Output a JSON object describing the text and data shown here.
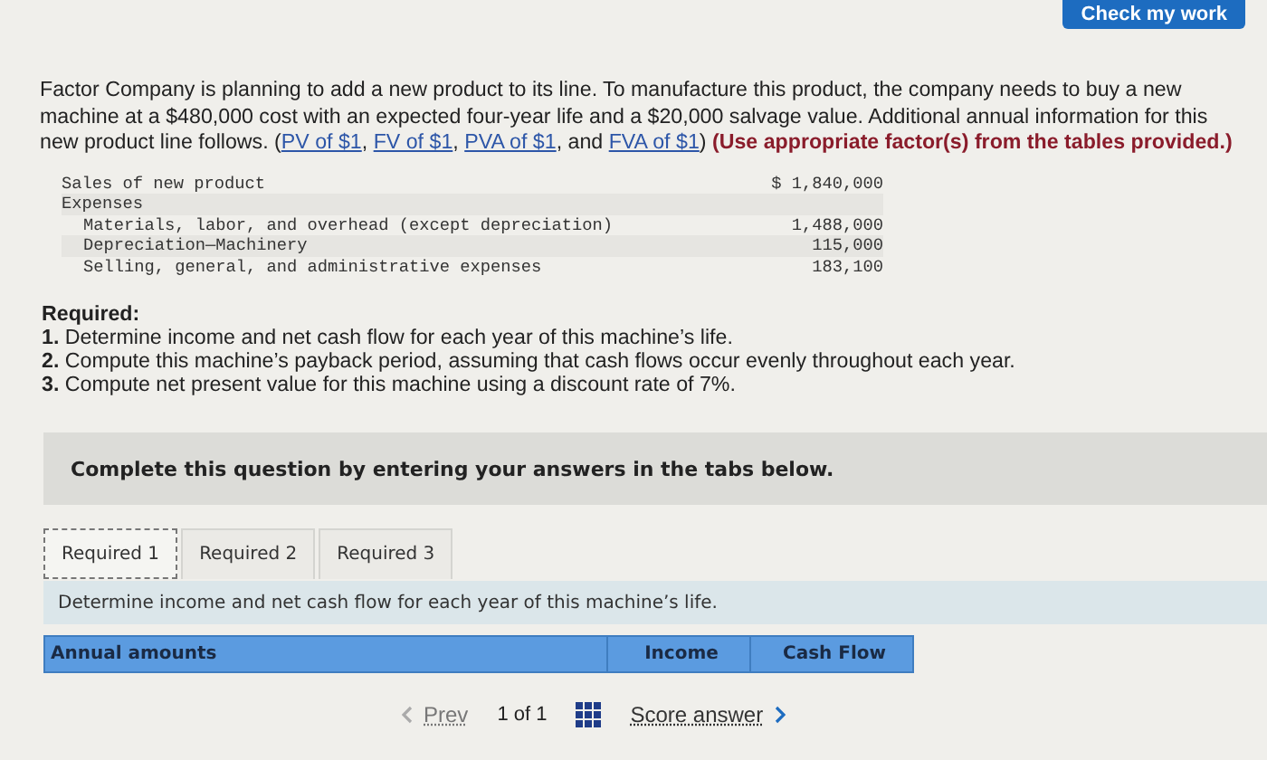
{
  "check_button": {
    "label": "Check my work"
  },
  "intro": [
    {
      "kind": "text",
      "text": "Factor Company is planning to add a new product to its line. To manufacture this product, the company needs to buy a new machine at a $480,000 cost with an expected four-year life and a $20,000 salvage value. Additional annual information for this new product line follows. ("
    },
    {
      "kind": "link",
      "text": "PV of $1"
    },
    {
      "kind": "text",
      "text": ", "
    },
    {
      "kind": "link",
      "text": "FV of $1"
    },
    {
      "kind": "text",
      "text": ", "
    },
    {
      "kind": "link",
      "text": "PVA of $1"
    },
    {
      "kind": "text",
      "text": ", and "
    },
    {
      "kind": "link",
      "text": "FVA of $1"
    },
    {
      "kind": "text",
      "text": ") "
    },
    {
      "kind": "note",
      "text": "(Use appropriate factor(s) from the tables provided.)"
    }
  ],
  "data_table": [
    {
      "label": "Sales of new product",
      "value": "$ 1,840,000"
    },
    {
      "label": "Expenses",
      "children": [
        {
          "label": "Materials, labor, and overhead (except depreciation)",
          "value": "1,488,000"
        },
        {
          "label": "Depreciation—Machinery",
          "value": "115,000"
        },
        {
          "label": "Selling, general, and administrative expenses",
          "value": "183,100"
        }
      ]
    }
  ],
  "required": {
    "title": "Required:",
    "items": [
      "**1.** Determine income and net cash flow for each year of this machine’s life.",
      "**2.** Compute this machine’s payback period, assuming that cash flows occur evenly throughout each year.",
      "**3.** Compute net present value for this machine using a discount rate of 7%."
    ]
  },
  "instructions": "Complete this question by entering your answers in the tabs below.",
  "tabs": [
    {
      "label": "Required 1",
      "selected": true
    },
    {
      "label": "Required 2",
      "selected": false
    },
    {
      "label": "Required 3",
      "selected": false
    }
  ],
  "task": "Determine income and net cash flow for each year of this machine’s life.",
  "answer_table": {
    "columns": [
      "Annual amounts",
      "Income",
      "Cash Flow"
    ]
  },
  "footer": {
    "prev": {
      "label": "Prev",
      "disabled": true
    },
    "page": "1 of 1",
    "next": {
      "label": "Score answer"
    }
  }
}
